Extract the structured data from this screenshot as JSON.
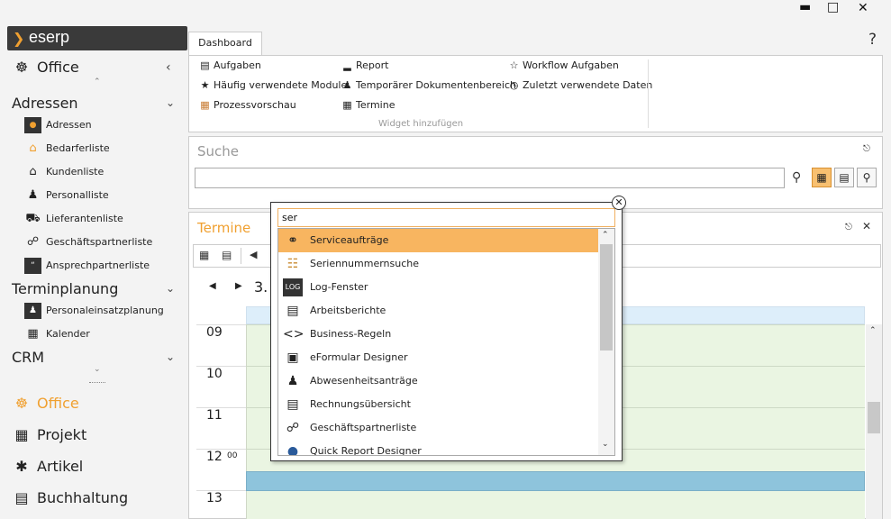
{
  "window": {
    "minimize": "▬",
    "maximize": "□",
    "close": "✕"
  },
  "logo": {
    "text": "eserp"
  },
  "sidebar": {
    "office_top": "Office",
    "groups": {
      "adressen": "Adressen",
      "terminplanung": "Terminplanung",
      "crm": "CRM"
    },
    "adressen_items": [
      "Adressen",
      "Bedarferliste",
      "Kundenliste",
      "Personalliste",
      "Lieferantenliste",
      "Geschäftspartnerliste",
      "Ansprechpartnerliste"
    ],
    "terminplanung_items": [
      "Personaleinsatzplanung",
      "Kalender"
    ],
    "modules": [
      "Office",
      "Projekt",
      "Artikel",
      "Buchhaltung"
    ]
  },
  "ribbon": {
    "tab": "Dashboard",
    "help": "?",
    "items": [
      "Aufgaben",
      "Häufig verwendete Module",
      "Prozessvorschau",
      "Report",
      "Temporärer Dokumentenbereich",
      "Termine",
      "Workflow Aufgaben",
      "Zuletzt verwendete Daten"
    ],
    "caption": "Widget hinzufügen"
  },
  "suche": {
    "title": "Suche",
    "input": ""
  },
  "termine": {
    "title": "Termine",
    "date": "3.",
    "hours": [
      "09",
      "10",
      "11",
      "12",
      "13"
    ],
    "minute_label": "00"
  },
  "popup": {
    "query": "ser",
    "items": [
      {
        "label": "Serviceaufträge",
        "icon": "headset-icon",
        "selected": true
      },
      {
        "label": "Seriennummernsuche",
        "icon": "barcode-icon"
      },
      {
        "label": "Log-Fenster",
        "icon": "log-icon"
      },
      {
        "label": "Arbeitsberichte",
        "icon": "report-icon"
      },
      {
        "label": "Business-Regeln",
        "icon": "code-icon"
      },
      {
        "label": "eFormular Designer",
        "icon": "form-icon"
      },
      {
        "label": "Abwesenheitsanträge",
        "icon": "walking-icon"
      },
      {
        "label": "Rechnungsübersicht",
        "icon": "invoice-icon"
      },
      {
        "label": "Geschäftspartnerliste",
        "icon": "handshake-icon"
      },
      {
        "label": "Quick Report Designer",
        "icon": "designer-icon"
      }
    ]
  }
}
